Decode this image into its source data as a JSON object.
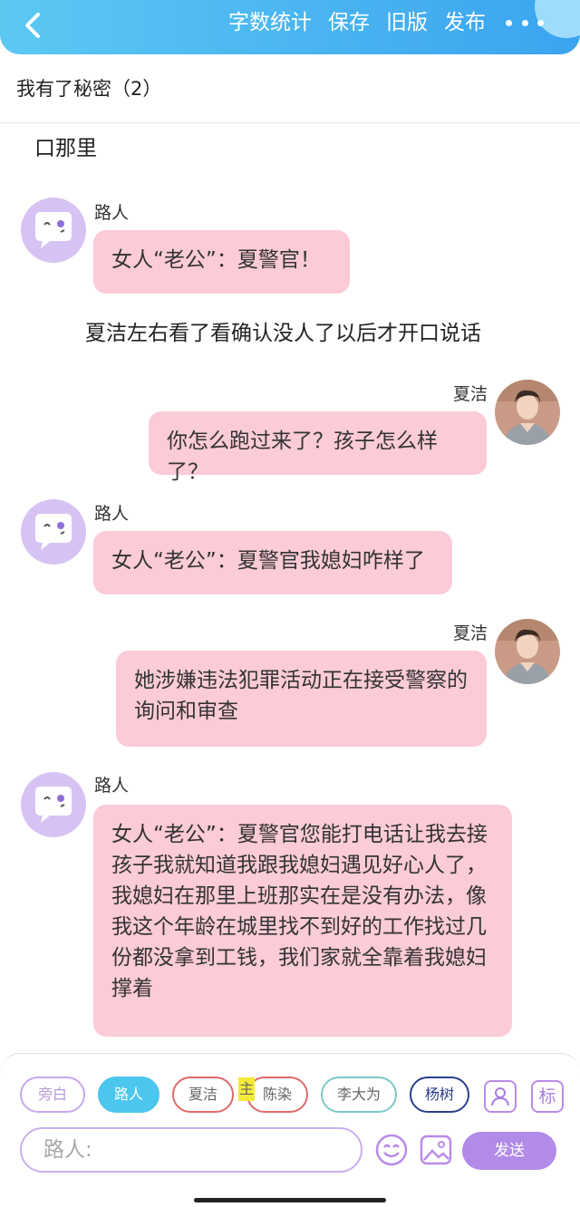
{
  "topbar": {
    "actions": {
      "word_count": "字数统计",
      "save": "保存",
      "old_version": "旧版",
      "publish": "发布"
    },
    "color_start": "#5cc8f2",
    "color_end": "#3aa4f0"
  },
  "title": "我有了秘密（2）",
  "chat": {
    "narration_1": "口那里",
    "narration_2": "夏洁左右看了看确认没人了以后才开口说话",
    "messages": [
      {
        "speaker": "路人",
        "text": "女人“老公”：夏警官！",
        "side": "left"
      },
      {
        "speaker": "夏洁",
        "text": "你怎么跑过来了？孩子怎么样了？",
        "side": "right"
      },
      {
        "speaker": "路人",
        "text": "女人“老公”：夏警官我媳妇咋样了",
        "side": "left"
      },
      {
        "speaker": "夏洁",
        "text": "她涉嫌违法犯罪活动正在接受警察的询问和审查",
        "side": "right"
      },
      {
        "speaker": "路人",
        "text": "女人“老公”：夏警官您能打电话让我去接孩子我就知道我跟我媳妇遇见好心人了，我媳妇在那里上班那实在是没有办法，像我这个年龄在城里找不到好的工作找过几份都没拿到工钱，我们家就全靠着我媳妇撑着",
        "side": "left"
      }
    ],
    "bubble_color": "#fbcbd7"
  },
  "roles": [
    {
      "label": "旁白",
      "color": "#c6a8ef",
      "selected": false
    },
    {
      "label": "路人",
      "color": "#4cc6ee",
      "selected": true
    },
    {
      "label": "夏洁",
      "color": "#e06a6a",
      "selected": false
    },
    {
      "label": "陈染",
      "color": "#e06a6a",
      "selected": false
    },
    {
      "label": "李大为",
      "color": "#7cc8c8",
      "selected": false
    },
    {
      "label": "杨树",
      "color": "#2c3e8c",
      "selected": false
    }
  ],
  "main_badge": "主",
  "tag_button": "标",
  "input": {
    "placeholder": "路人:"
  },
  "send_label": "发送",
  "send_color": "#b28ae8"
}
